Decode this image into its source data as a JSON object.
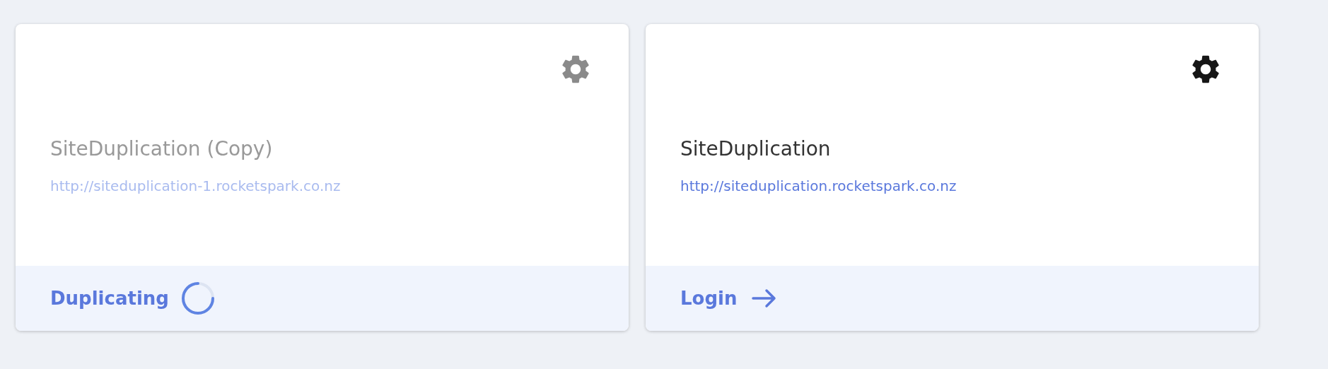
{
  "sites": [
    {
      "name": "SiteDuplication (Copy)",
      "url": "http://siteduplication-1.rocketspark.co.nz",
      "disabled": true,
      "footer": {
        "kind": "progress",
        "label": "Duplicating"
      }
    },
    {
      "name": "SiteDuplication",
      "url": "http://siteduplication.rocketspark.co.nz",
      "disabled": false,
      "footer": {
        "kind": "link",
        "label": "Login"
      }
    }
  ]
}
